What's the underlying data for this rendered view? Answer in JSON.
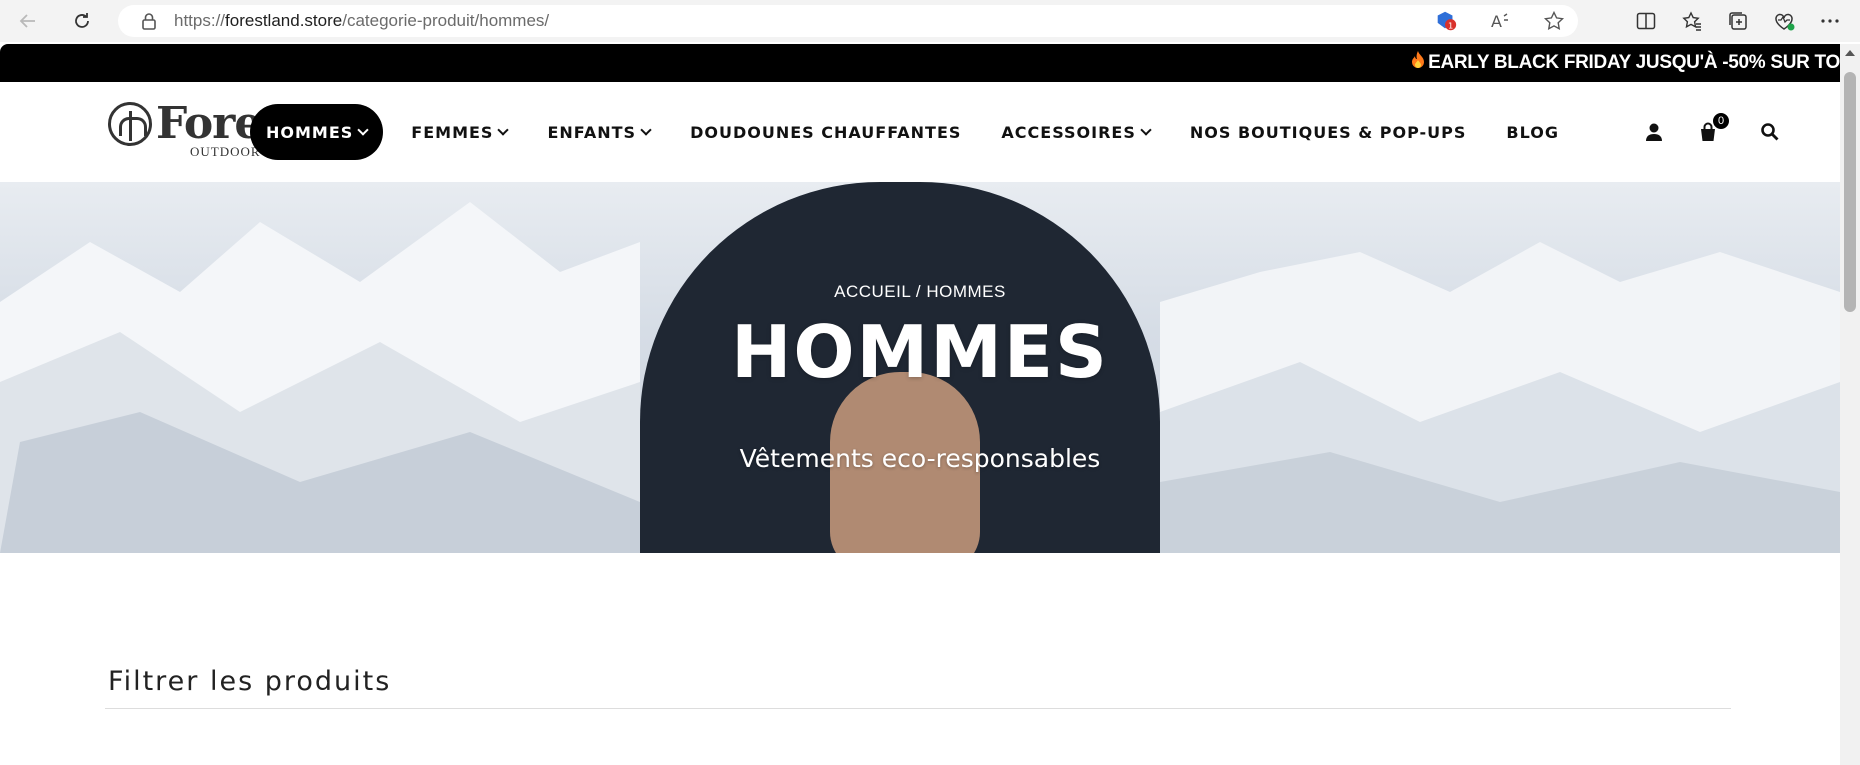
{
  "browser": {
    "url_prefix": "https://",
    "url_host": "forestland.store",
    "url_path": "/categorie-produit/hommes/"
  },
  "promo_bar": {
    "icon": "fire-emoji",
    "text": "EARLY BLACK FRIDAY JUSQU'À -50% SUR TO"
  },
  "logo": {
    "word": "Fores",
    "sub": "OUTDOOR"
  },
  "nav": {
    "items": [
      {
        "label": "HOMMES",
        "dropdown": true,
        "active": true
      },
      {
        "label": "FEMMES",
        "dropdown": true
      },
      {
        "label": "ENFANTS",
        "dropdown": true
      },
      {
        "label": "DOUDOUNES CHAUFFANTES",
        "dropdown": false
      },
      {
        "label": "ACCESSOIRES",
        "dropdown": true
      },
      {
        "label": "NOS BOUTIQUES & POP-UPS",
        "dropdown": false
      },
      {
        "label": "BLOG",
        "dropdown": false
      }
    ],
    "cart_count": "0"
  },
  "hero": {
    "breadcrumb": "ACCUEIL / HOMMES",
    "title": "HOMMES",
    "subtitle": "Vêtements eco-responsables"
  },
  "filters": {
    "title": "Filtrer les produits"
  },
  "colors": {
    "promo_bg": "#000000",
    "active_nav_bg": "#000000",
    "hero_text": "#ffffff"
  }
}
